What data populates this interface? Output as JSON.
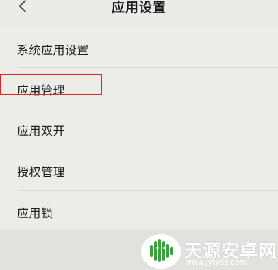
{
  "header": {
    "title": "应用设置",
    "back_icon": "chevron-left-icon"
  },
  "settings_list": {
    "items": [
      {
        "label": "系统应用设置"
      },
      {
        "label": "应用管理",
        "highlighted": true
      },
      {
        "label": "应用双开"
      },
      {
        "label": "授权管理"
      },
      {
        "label": "应用锁"
      }
    ]
  },
  "annotation": {
    "highlight_color": "#e0262a"
  },
  "watermark": {
    "brand": "天源安卓网",
    "url": "www.jytyaz.com",
    "logo_icon": "android-robot-icon",
    "logo_color": "#3aa13c"
  },
  "colors": {
    "background": "#ecece9",
    "text": "#1e1e1e",
    "divider": "#d9d9d5"
  }
}
